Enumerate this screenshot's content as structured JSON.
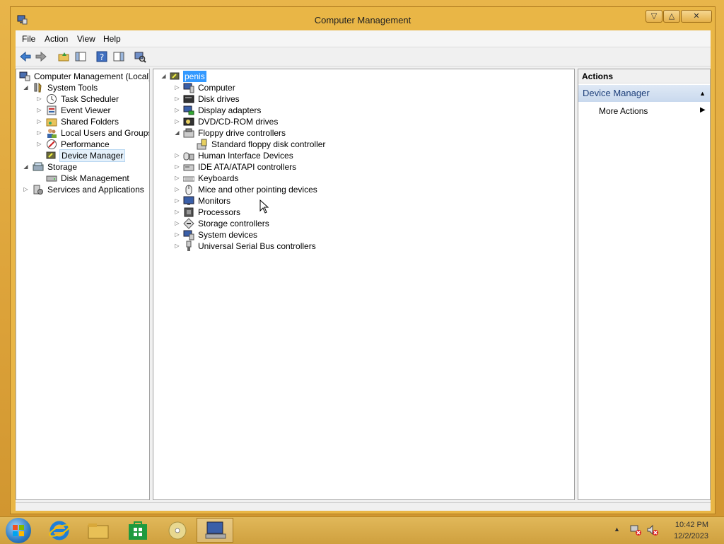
{
  "window": {
    "title": "Computer Management"
  },
  "menu": {
    "items": [
      "File",
      "Action",
      "View",
      "Help"
    ]
  },
  "left_tree": {
    "root": "Computer Management (Local)",
    "system_tools": "System Tools",
    "task_scheduler": "Task Scheduler",
    "event_viewer": "Event Viewer",
    "shared_folders": "Shared Folders",
    "local_users": "Local Users and Groups",
    "performance": "Performance",
    "device_manager": "Device Manager",
    "storage": "Storage",
    "disk_management": "Disk Management",
    "services": "Services and Applications"
  },
  "device_tree": {
    "root": "penis",
    "items": [
      "Computer",
      "Disk drives",
      "Display adapters",
      "DVD/CD-ROM drives",
      "Floppy drive controllers",
      "Standard floppy disk controller",
      "Human Interface Devices",
      "IDE ATA/ATAPI controllers",
      "Keyboards",
      "Mice and other pointing devices",
      "Monitors",
      "Processors",
      "Storage controllers",
      "System devices",
      "Universal Serial Bus controllers"
    ]
  },
  "actions": {
    "header": "Actions",
    "section": "Device Manager",
    "more": "More Actions"
  },
  "tray": {
    "time": "10:42 PM",
    "date": "12/2/2023"
  },
  "colors": {
    "accent": "#3399ff",
    "taskbar": "#d9a33a"
  }
}
